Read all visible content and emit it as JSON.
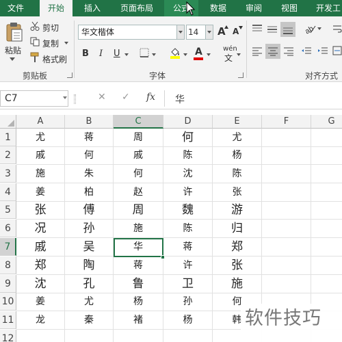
{
  "tabs": [
    {
      "label": "文件",
      "active": false
    },
    {
      "label": "开始",
      "active": true
    },
    {
      "label": "插入",
      "active": false
    },
    {
      "label": "页面布局",
      "active": false
    },
    {
      "label": "公式",
      "active": false
    },
    {
      "label": "数据",
      "active": false
    },
    {
      "label": "审阅",
      "active": false
    },
    {
      "label": "视图",
      "active": false
    },
    {
      "label": "开发工",
      "active": false
    }
  ],
  "ribbon": {
    "clipboard": {
      "paste": "粘贴",
      "cut": "剪切",
      "copy": "复制",
      "format_painter": "格式刷",
      "label": "剪贴板"
    },
    "font": {
      "name": "华文楷体",
      "size": "14",
      "label": "字体",
      "bold": "B",
      "italic": "I",
      "underline": "U",
      "grow": "A",
      "shrink": "A",
      "phonetic": "wén"
    },
    "alignment": {
      "label": "对齐方式"
    }
  },
  "formula_bar": {
    "name_box": "C7",
    "cancel": "✕",
    "enter": "✓",
    "fx": "fx",
    "content": "华"
  },
  "columns": [
    "A",
    "B",
    "C",
    "D",
    "E",
    "F",
    "G"
  ],
  "selected_column": "C",
  "rows": [
    "1",
    "2",
    "3",
    "4",
    "5",
    "6",
    "7",
    "8",
    "9",
    "10",
    "11",
    "12"
  ],
  "selected_row": "7",
  "cells": [
    [
      "尤",
      "蒋",
      "周",
      "何",
      "尤"
    ],
    [
      "戚",
      "何",
      "戚",
      "陈",
      "杨"
    ],
    [
      "施",
      "朱",
      "何",
      "沈",
      "陈"
    ],
    [
      "姜",
      "柏",
      "赵",
      "许",
      "张"
    ],
    [
      "张",
      "傅",
      "周",
      "魏",
      "游"
    ],
    [
      "况",
      "孙",
      "施",
      "陈",
      "归"
    ],
    [
      "戚",
      "吴",
      "华",
      "蒋",
      "郑"
    ],
    [
      "郑",
      "陶",
      "蒋",
      "许",
      "张"
    ],
    [
      "沈",
      "孔",
      "鲁",
      "卫",
      "施"
    ],
    [
      "姜",
      "尤",
      "杨",
      "孙",
      "何"
    ],
    [
      "龙",
      "秦",
      "褚",
      "杨",
      "韩"
    ]
  ],
  "watermark": "软件技巧",
  "colors": {
    "accent": "#217346",
    "ribbon_bg": "#f3f3f3",
    "header_bg": "#f3f3f3",
    "selected_header_bg": "#d2d2d2"
  }
}
